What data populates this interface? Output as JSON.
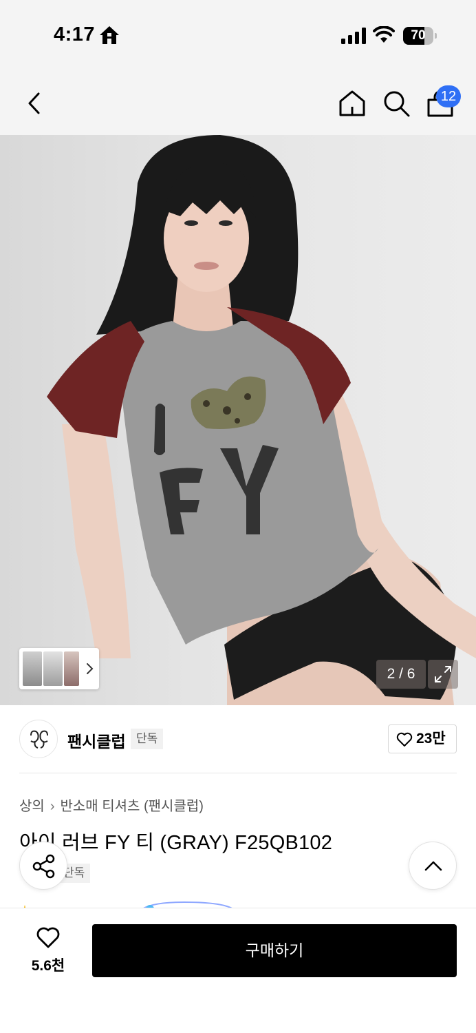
{
  "status_bar": {
    "time": "4:17",
    "battery": "70",
    "battery_level": 0.7,
    "icons": [
      "home-icon",
      "signal-icon",
      "wifi-icon",
      "battery-icon"
    ]
  },
  "nav": {
    "cart_count": "12",
    "accent_color": "#2f6ff5",
    "icons": [
      "back-icon",
      "home-icon",
      "search-icon",
      "cart-icon"
    ]
  },
  "gallery": {
    "counter": "2 / 6",
    "icons": [
      "chevron-right-icon",
      "expand-icon"
    ]
  },
  "brand": {
    "name": "팬시클럽",
    "badge": "단독",
    "likes": "23만"
  },
  "product": {
    "breadcrumb": [
      "상의",
      "반소매 티셔츠 (팬시클럽)"
    ],
    "title": "아이 러브 FY 티 (GRAY) F25QB102",
    "badge": "단독"
  },
  "bottom_bar": {
    "wish_count": "5.6천",
    "buy_label": "구매하기"
  },
  "colors": {
    "background": "#ffffff",
    "header_background": "#f4f4f4",
    "buy_button": "#000000",
    "badge_blue": "#2f6ff5"
  }
}
